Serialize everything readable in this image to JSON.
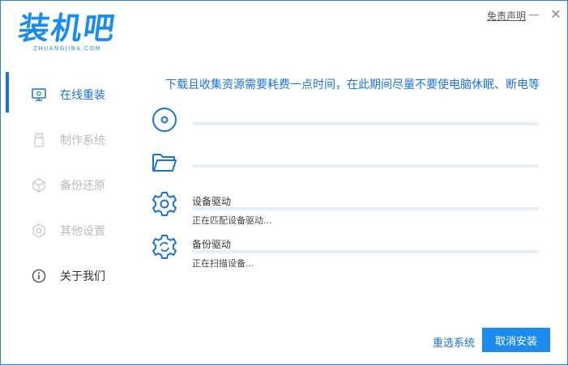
{
  "app": {
    "logo_text": "装机吧",
    "logo_sub": "ZHUANGJIBA.COM",
    "disclaimer": "免责声明",
    "close_glyph": "✕"
  },
  "sidebar": {
    "items": [
      {
        "label": "在线重装",
        "icon": "monitor-icon",
        "state": "active"
      },
      {
        "label": "制作系统",
        "icon": "usb-icon",
        "state": "disabled"
      },
      {
        "label": "备份还原",
        "icon": "cube-icon",
        "state": "disabled"
      },
      {
        "label": "其他设置",
        "icon": "gear-icon",
        "state": "disabled"
      },
      {
        "label": "关于我们",
        "icon": "info-icon",
        "state": "normal"
      }
    ]
  },
  "main": {
    "notice": "下载且收集资源需要耗费一点时间，在此期间尽量不要使电脑休眠、断电等",
    "steps": [
      {
        "icon": "disc-icon",
        "title": "",
        "status": ""
      },
      {
        "icon": "folder-icon",
        "title": "",
        "status": ""
      },
      {
        "icon": "gear-icon",
        "title": "设备驱动",
        "status": "正在匹配设备驱动..."
      },
      {
        "icon": "gear-refresh-icon",
        "title": "备份驱动",
        "status": "正在扫描设备..."
      }
    ]
  },
  "footer": {
    "reselect_label": "重选系统",
    "cancel_label": "取消安装"
  },
  "colors": {
    "accent": "#1a8cf0",
    "accent_dark": "#1a73d9",
    "bar_track": "#e6eef8",
    "disabled_text": "#bbbbbb"
  }
}
